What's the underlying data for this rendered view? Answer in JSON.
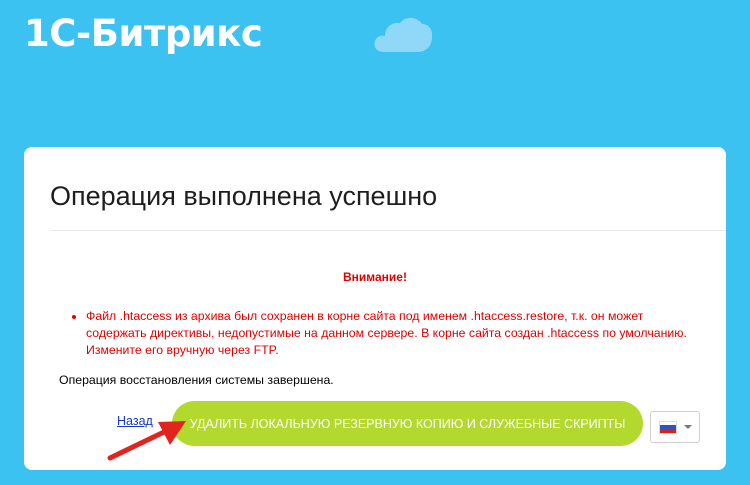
{
  "header": {
    "logo_text": "1С-Битрикс",
    "cloud_icon": "cloud-icon"
  },
  "card": {
    "title": "Операция выполнена успешно",
    "warning_title": "Внимание!",
    "warnings": [
      "Файл .htaccess из архива был сохранен в корне сайта под именем .htaccess.restore, т.к. он может содержать директивы, недопустимые на данном сервере. В корне сайта создан .htaccess по умолчанию. Измените его вручную через FTP."
    ],
    "status_text": "Операция восстановления системы завершена.",
    "back_link": "Назад",
    "delete_button": "УДАЛИТЬ ЛОКАЛЬНУЮ РЕЗЕРВНУЮ КОПИЮ И СЛУЖЕБНЫЕ СКРИПТЫ",
    "language_flag": "ru-flag-icon"
  },
  "colors": {
    "background": "#3cc2f0",
    "button": "#b3d92e",
    "warning": "#e00000",
    "arrow": "#e3231d"
  }
}
